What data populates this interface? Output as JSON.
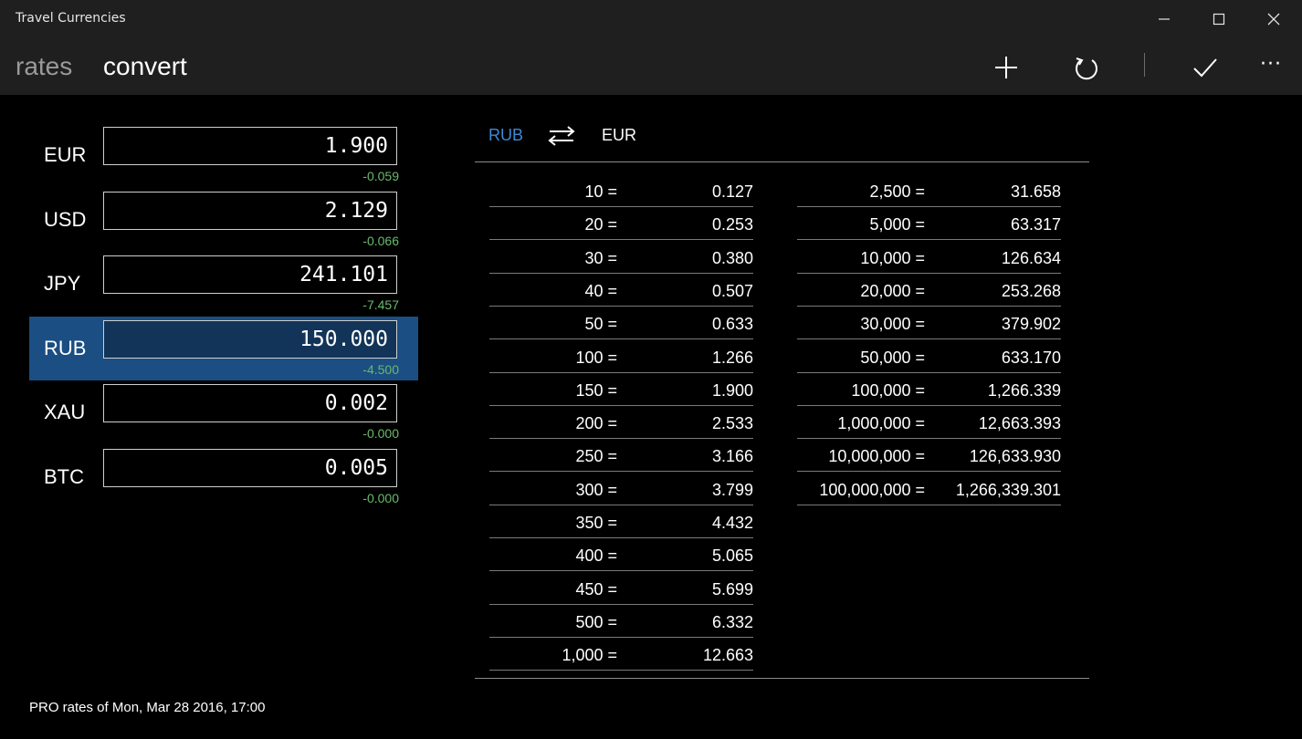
{
  "window": {
    "title": "Travel Currencies"
  },
  "tabs": [
    {
      "label": "rates"
    },
    {
      "label": "convert"
    }
  ],
  "toolbar": {
    "add_icon": "plus-icon",
    "refresh_icon": "refresh-icon",
    "accept_icon": "check-icon",
    "more_label": "···"
  },
  "rates": [
    {
      "code": "EUR",
      "value": "1.900",
      "change": "-0.059"
    },
    {
      "code": "USD",
      "value": "2.129",
      "change": "-0.066"
    },
    {
      "code": "JPY",
      "value": "241.101",
      "change": "-7.457"
    },
    {
      "code": "RUB",
      "value": "150.000",
      "change": "-4.500"
    },
    {
      "code": "XAU",
      "value": "0.002",
      "change": "-0.000"
    },
    {
      "code": "BTC",
      "value": "0.005",
      "change": "-0.000"
    }
  ],
  "selected_index": 3,
  "footer": {
    "text": "PRO rates of  Mon, Mar 28 2016, 17:00"
  },
  "conversion": {
    "from": "RUB",
    "to": "EUR",
    "left_table": [
      {
        "amount": "10 =",
        "result": "0.127"
      },
      {
        "amount": "20 =",
        "result": "0.253"
      },
      {
        "amount": "30 =",
        "result": "0.380"
      },
      {
        "amount": "40 =",
        "result": "0.507"
      },
      {
        "amount": "50 =",
        "result": "0.633"
      },
      {
        "amount": "100 =",
        "result": "1.266"
      },
      {
        "amount": "150 =",
        "result": "1.900"
      },
      {
        "amount": "200 =",
        "result": "2.533"
      },
      {
        "amount": "250 =",
        "result": "3.166"
      },
      {
        "amount": "300 =",
        "result": "3.799"
      },
      {
        "amount": "350 =",
        "result": "4.432"
      },
      {
        "amount": "400 =",
        "result": "5.065"
      },
      {
        "amount": "450 =",
        "result": "5.699"
      },
      {
        "amount": "500 =",
        "result": "6.332"
      },
      {
        "amount": "1,000 =",
        "result": "12.663"
      }
    ],
    "right_table": [
      {
        "amount": "2,500 =",
        "result": "31.658"
      },
      {
        "amount": "5,000 =",
        "result": "63.317"
      },
      {
        "amount": "10,000 =",
        "result": "126.634"
      },
      {
        "amount": "20,000 =",
        "result": "253.268"
      },
      {
        "amount": "30,000 =",
        "result": "379.902"
      },
      {
        "amount": "50,000 =",
        "result": "633.170"
      },
      {
        "amount": "100,000 =",
        "result": "1,266.339"
      },
      {
        "amount": "1,000,000 =",
        "result": "12,663.393"
      },
      {
        "amount": "10,000,000 =",
        "result": "126,633.930"
      },
      {
        "amount": "100,000,000 =",
        "result": "1,266,339.301"
      }
    ]
  }
}
